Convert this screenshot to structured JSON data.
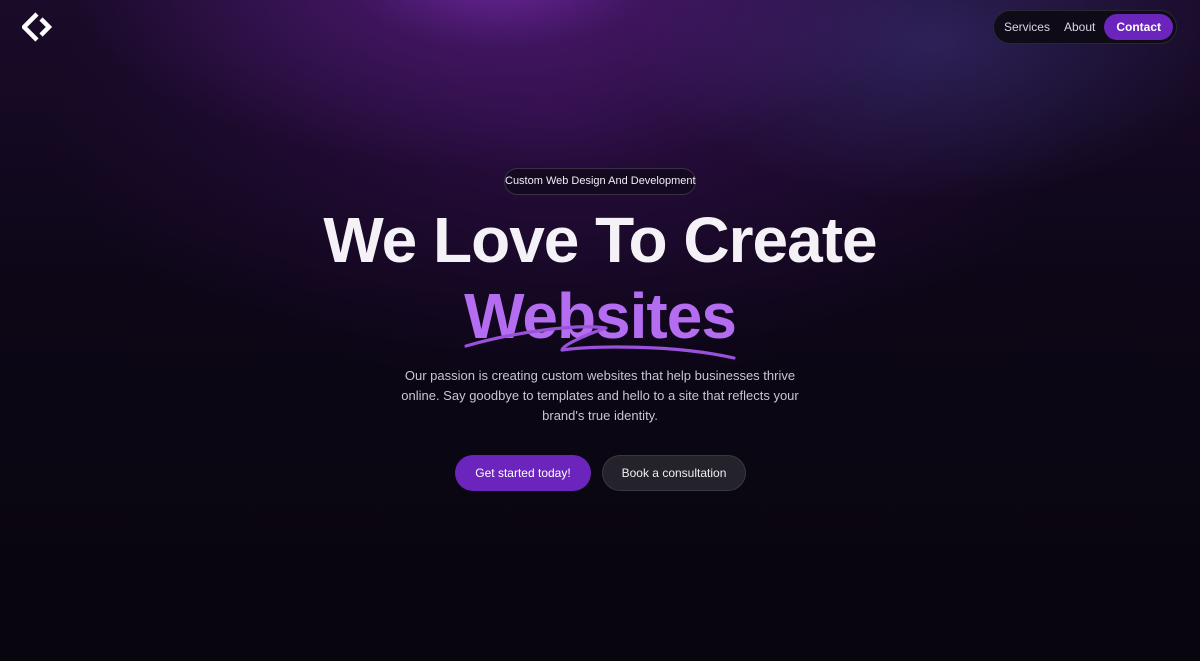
{
  "header": {
    "logo_icon": "brackets-diamond-icon",
    "nav": {
      "services_label": "Services",
      "about_label": "About",
      "contact_label": "Contact"
    }
  },
  "hero": {
    "badge": "Custom Web Design And Development",
    "headline_line1": "We Love To Create",
    "headline_line2": "Websites",
    "description": "Our passion is creating custom websites that help businesses thrive online. Say goodbye to templates and hello to a site that reflects your brand's true identity.",
    "primary_cta": "Get started today!",
    "secondary_cta": "Book a consultation"
  },
  "colors": {
    "accent": "#6b24bc",
    "accent_light": "#b46df0",
    "background": "#09050f",
    "button_dark": "#24222a"
  }
}
